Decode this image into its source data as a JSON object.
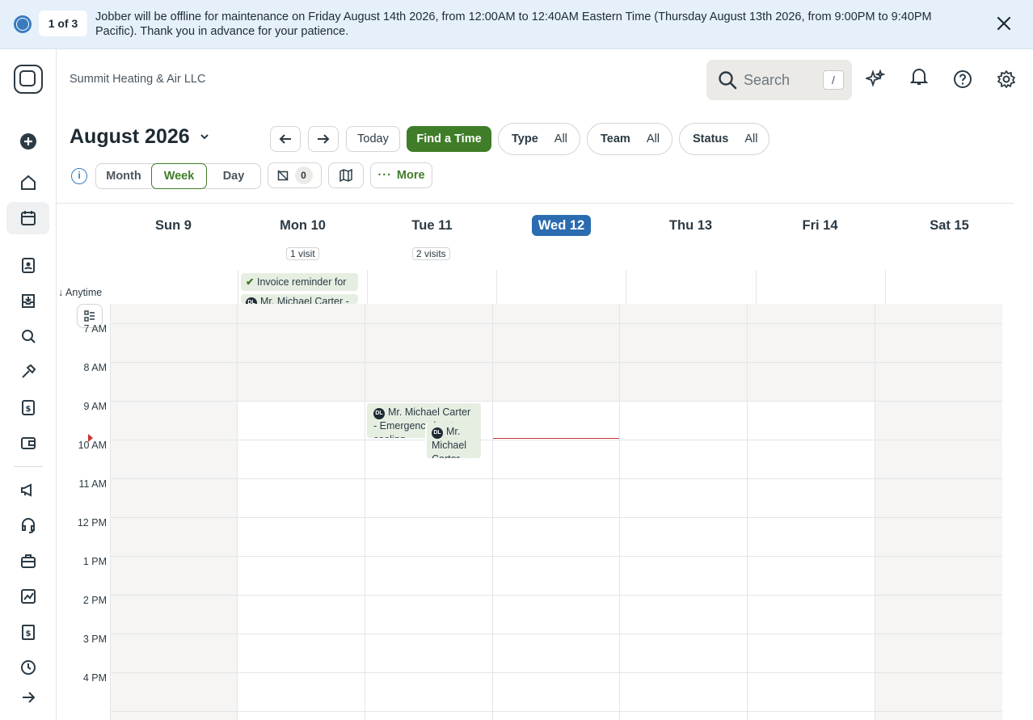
{
  "banner": {
    "pager": "1 of 3",
    "message": "Jobber will be offline for maintenance on Friday August 14th 2026, from 12:00AM to 12:40AM Eastern Time (Thursday August 13th 2026, from 9:00PM to 9:40PM Pacific). Thank you in advance for your patience.",
    "close_icon": "close-icon"
  },
  "header": {
    "company": "Summit Heating & Air LLC",
    "search_placeholder": "Search",
    "search_shortcut": "/"
  },
  "toolbar": {
    "title": "August 2026",
    "today": "Today",
    "find_time": "Find a Time",
    "filters": [
      {
        "label": "Type",
        "value": "All"
      },
      {
        "label": "Team",
        "value": "All"
      },
      {
        "label": "Status",
        "value": "All"
      }
    ],
    "views": [
      "Month",
      "Week",
      "Day"
    ],
    "active_view": "Week",
    "unscheduled_count": "0",
    "more": "More"
  },
  "days": [
    {
      "label": "Sun 9",
      "visits": ""
    },
    {
      "label": "Mon 10",
      "visits": "1 visit"
    },
    {
      "label": "Tue 11",
      "visits": "2 visits"
    },
    {
      "label": "Wed 12",
      "visits": "",
      "today": true
    },
    {
      "label": "Thu 13",
      "visits": ""
    },
    {
      "label": "Fri 14",
      "visits": ""
    },
    {
      "label": "Sat 15",
      "visits": ""
    }
  ],
  "anytime": {
    "label": "Anytime",
    "events": [
      {
        "text": "Invoice reminder for",
        "icon": "check-icon"
      },
      {
        "text": "Mr. Michael Carter -",
        "avatar": "DL"
      }
    ]
  },
  "hours": [
    "7 AM",
    "8 AM",
    "9 AM",
    "10 AM",
    "11 AM",
    "12 PM",
    "1 PM",
    "2 PM",
    "3 PM",
    "4 PM"
  ],
  "events": [
    {
      "avatar": "DL",
      "text": "Mr. Michael Carter - Emergency heat cooling"
    },
    {
      "avatar": "DL",
      "text": "Mr. Michael Carter - Rep"
    }
  ],
  "colors": {
    "brand_green": "#3f7d28",
    "today_blue": "#2b6cb0",
    "now_line": "#cc3333",
    "event_bg": "#e6eee2"
  }
}
